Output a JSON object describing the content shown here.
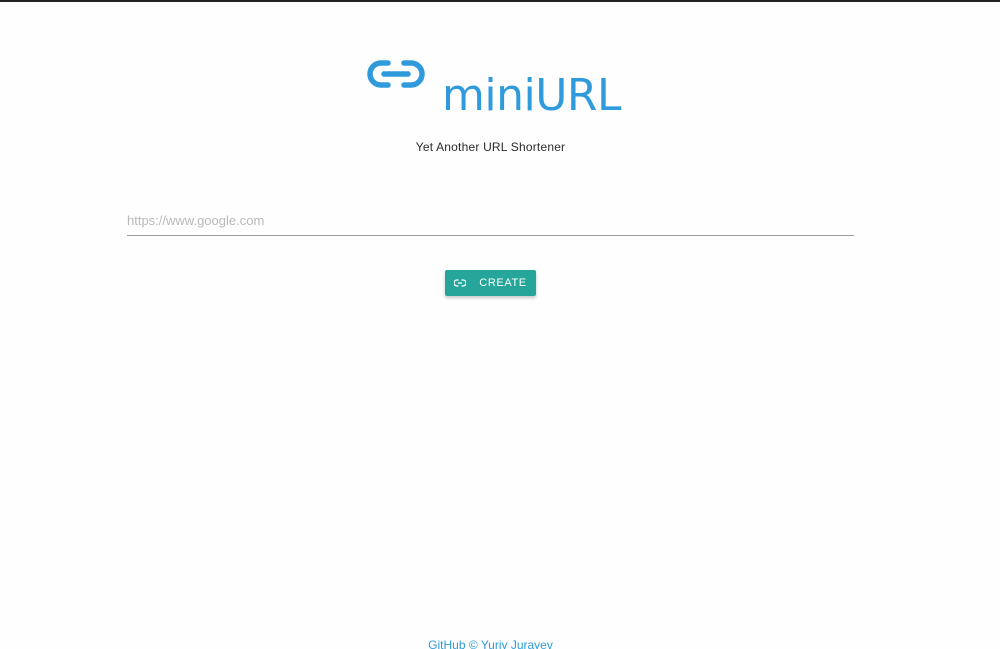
{
  "app": {
    "name": "miniURL",
    "tagline": "Yet Another URL Shortener",
    "logo_icon": "link-icon",
    "accent_color": "#2f9bdc"
  },
  "form": {
    "url_placeholder": "https://www.google.com",
    "url_value": "",
    "create_label": "CREATE",
    "create_icon": "link-icon",
    "button_color": "#26a69a"
  },
  "footer": {
    "github_label": "GitHub",
    "copyright_symbol": "©",
    "author": "Yuriy Jurayev"
  }
}
